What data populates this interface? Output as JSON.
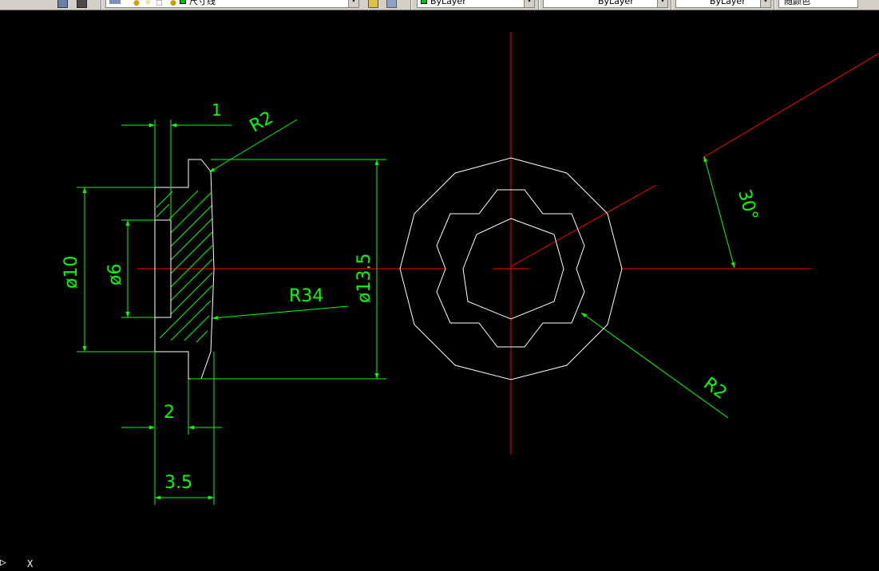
{
  "toolbar": {
    "layer_name": "尺寸线",
    "color_value": "ByLayer",
    "linetype_value": "ByLayer",
    "lineweight_value": "ByLayer",
    "plotstyle_value": "随颜色"
  },
  "drawing": {
    "dims": {
      "width_1": "1",
      "fillet_r2_top": "R2",
      "dia_10": "ø10",
      "dia_6": "ø6",
      "r34": "R34",
      "dia_13_5": "ø13.5",
      "width_2": "2",
      "width_3_5": "3.5",
      "angle_30": "30°",
      "fillet_r2_right": "R2"
    },
    "colors": {
      "geometry": "#ffffff",
      "dimension": "#00ff00",
      "centerline": "#ff0000",
      "background": "#000000"
    }
  },
  "ucs": {
    "x_label": "X"
  }
}
